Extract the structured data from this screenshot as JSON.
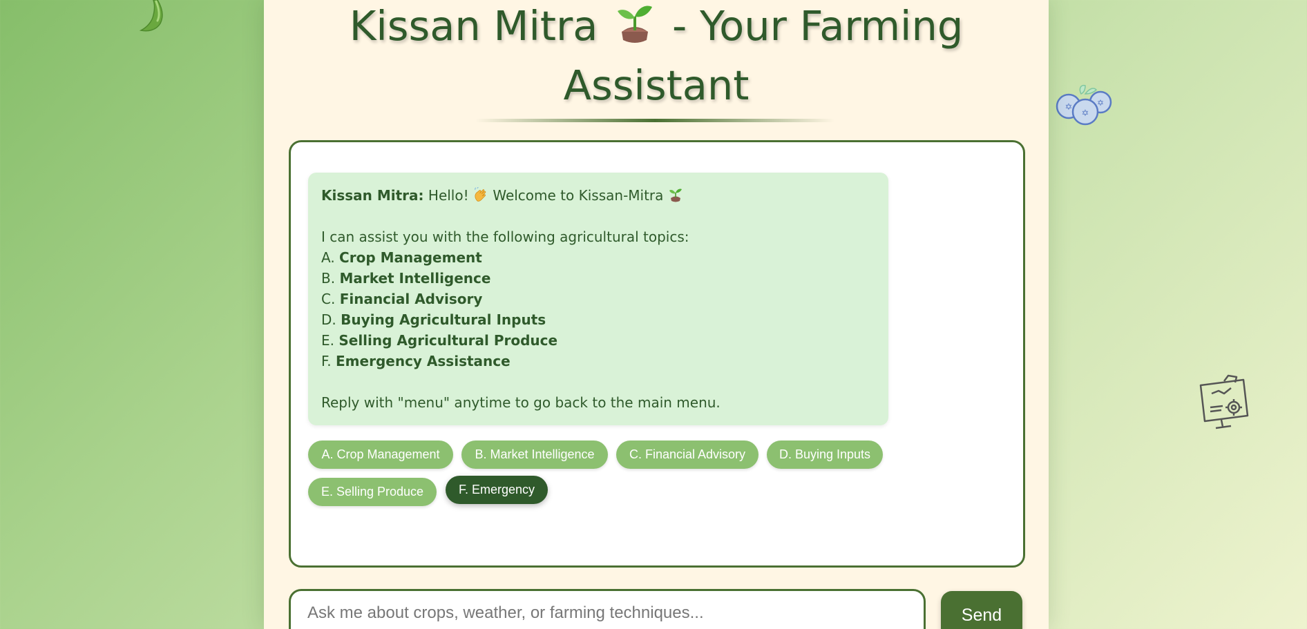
{
  "header": {
    "title_part1": "Kissan Mitra",
    "title_part2": "- Your Farming",
    "title_line2": "Assistant",
    "title_icon": "sprout-icon"
  },
  "background_decorations": [
    "chili-pepper-icon",
    "blueberries-icon",
    "monitor-dashboard-icon"
  ],
  "chat": {
    "bot_message": {
      "speaker": "Kissan Mitra:",
      "greeting_text": "Hello!",
      "greeting_icon": "waving-hand-icon",
      "welcome_text": "Welcome to Kissan-Mitra",
      "welcome_icon": "sprout-icon",
      "intro": "I can assist you with the following agricultural topics:",
      "options": [
        {
          "prefix": "A.",
          "label": "Crop Management"
        },
        {
          "prefix": "B.",
          "label": "Market Intelligence"
        },
        {
          "prefix": "C.",
          "label": "Financial Advisory"
        },
        {
          "prefix": "D.",
          "label": "Buying Agricultural Inputs"
        },
        {
          "prefix": "E.",
          "label": "Selling Agricultural Produce"
        },
        {
          "prefix": "F.",
          "label": "Emergency Assistance"
        }
      ],
      "footer": "Reply with \"menu\" anytime to go back to the main menu."
    },
    "quick_replies": [
      {
        "label": "A. Crop Management"
      },
      {
        "label": "B. Market Intelligence"
      },
      {
        "label": "C. Financial Advisory"
      },
      {
        "label": "D. Buying Inputs"
      },
      {
        "label": "E. Selling Produce"
      },
      {
        "label": "F. Emergency",
        "active": true
      }
    ]
  },
  "input": {
    "placeholder": "Ask me about crops, weather, or farming techniques...",
    "value": ""
  },
  "send_button": {
    "label": "Send"
  },
  "colors": {
    "primary_green": "#4a7032",
    "dark_green": "#2f5a2b",
    "chip_green": "#8cc070",
    "bubble_bg": "#d9f2d7",
    "container_bg": "#fff6e4"
  }
}
